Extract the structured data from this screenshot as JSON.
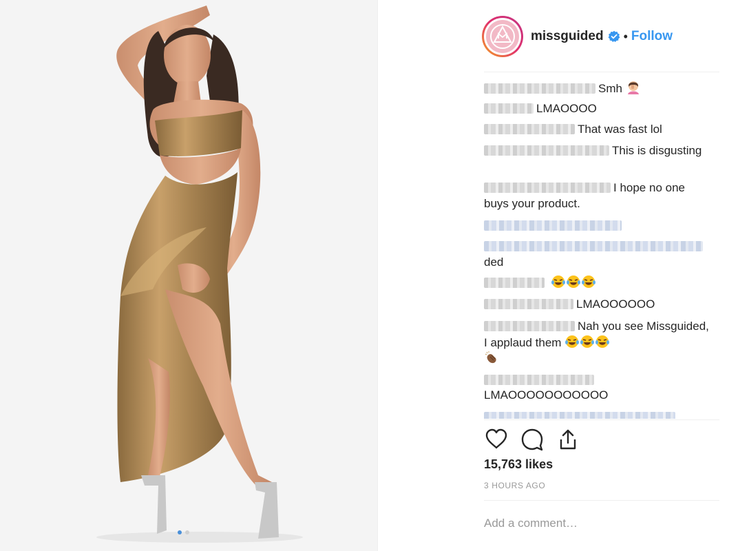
{
  "account": {
    "username": "missguided",
    "separator": "•",
    "follow_label": "Follow",
    "brand_color": "#f2b9c6",
    "link_color": "#3897f0"
  },
  "comments": [
    {
      "text": "Smh",
      "emoji": "facepalm"
    },
    {
      "text": "LMAOOOO"
    },
    {
      "text": "That was fast lol"
    },
    {
      "text": "This is disgusting"
    },
    {
      "text": "I hope no one buys your product."
    },
    {
      "text": "ded"
    },
    {
      "text": "",
      "emoji": "laughing-tears x3"
    },
    {
      "text": "LMAOOOOOO"
    },
    {
      "text": "Nah you see Missguided, I applaud them",
      "emoji": "laughing-tears x3, clapping-hands"
    },
    {
      "text": "LMAOOOOOOOOOOO"
    }
  ],
  "engagement": {
    "likes": "15,763 likes",
    "timestamp": "3 HOURS AGO"
  },
  "composer": {
    "placeholder": "Add a comment…"
  },
  "carousel": {
    "count": 2,
    "active": 1
  }
}
